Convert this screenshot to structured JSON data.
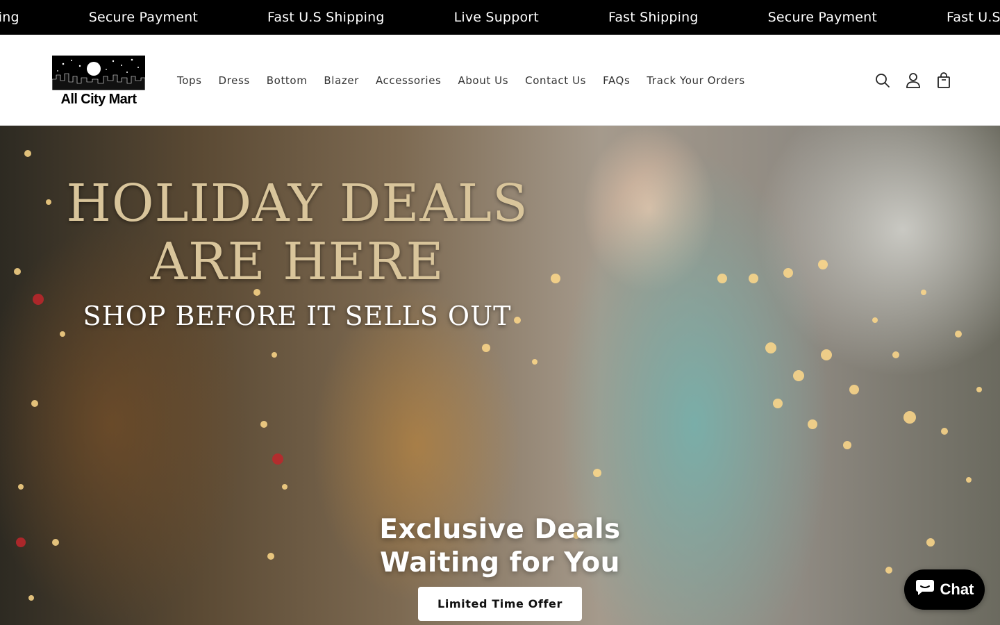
{
  "announcement": {
    "items": [
      "Fast Shipping",
      "Secure Payment",
      "Fast U.S Shipping",
      "Live Support",
      "Fast Shipping",
      "Secure Payment",
      "Fast U.S Shipping"
    ]
  },
  "brand": {
    "name": "All City Mart"
  },
  "nav": {
    "items": [
      "Tops",
      "Dress",
      "Bottom",
      "Blazer",
      "Accessories",
      "About Us",
      "Contact Us",
      "FAQs",
      "Track Your Orders"
    ]
  },
  "header_icons": [
    "search-icon",
    "account-icon",
    "cart-icon"
  ],
  "hero": {
    "title_line1": "HOLIDAY DEALS",
    "title_line2": "ARE HERE",
    "subtitle": "SHOP BEFORE IT SELLS OUT",
    "heading_line1": "Exclusive Deals",
    "heading_line2": "Waiting for You",
    "button_label": "Limited Time Offer"
  },
  "chat": {
    "label": "Chat"
  },
  "colors": {
    "announcement_bg": "#000000",
    "title_gold": "#d9c59b",
    "button_bg": "#ffffff"
  }
}
